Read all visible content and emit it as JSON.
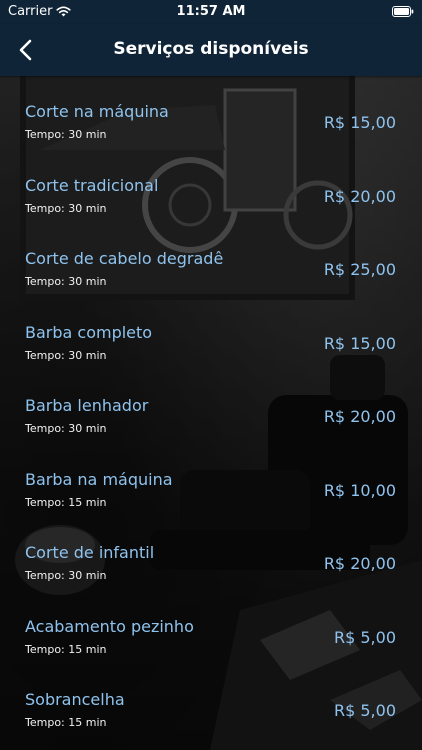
{
  "status_bar": {
    "carrier": "Carrier",
    "time": "11:57 AM"
  },
  "nav": {
    "title": "Serviços disponíveis"
  },
  "services": [
    {
      "name": "Corte na máquina",
      "duration": "Tempo: 30 min",
      "price": "R$ 15,00"
    },
    {
      "name": "Corte tradicional",
      "duration": "Tempo: 30 min",
      "price": "R$ 20,00"
    },
    {
      "name": "Corte de cabelo degradê",
      "duration": "Tempo: 30 min",
      "price": "R$ 25,00"
    },
    {
      "name": "Barba completo",
      "duration": "Tempo: 30 min",
      "price": "R$ 15,00"
    },
    {
      "name": "Barba lenhador",
      "duration": "Tempo: 30 min",
      "price": "R$ 20,00"
    },
    {
      "name": "Barba na máquina",
      "duration": "Tempo: 15 min",
      "price": "R$ 10,00"
    },
    {
      "name": "Corte de infantil",
      "duration": "Tempo: 30 min",
      "price": "R$ 20,00"
    },
    {
      "name": "Acabamento pezinho",
      "duration": "Tempo: 15 min",
      "price": "R$ 5,00"
    },
    {
      "name": "Sobrancelha",
      "duration": "Tempo: 15 min",
      "price": "R$ 5,00"
    }
  ],
  "colors": {
    "nav_background": "#0f2436",
    "accent_text": "#8fc3ee",
    "secondary_text": "#f2f2f2"
  },
  "icons": {
    "back": "chevron-left-icon",
    "wifi": "wifi-icon",
    "battery": "battery-icon"
  }
}
